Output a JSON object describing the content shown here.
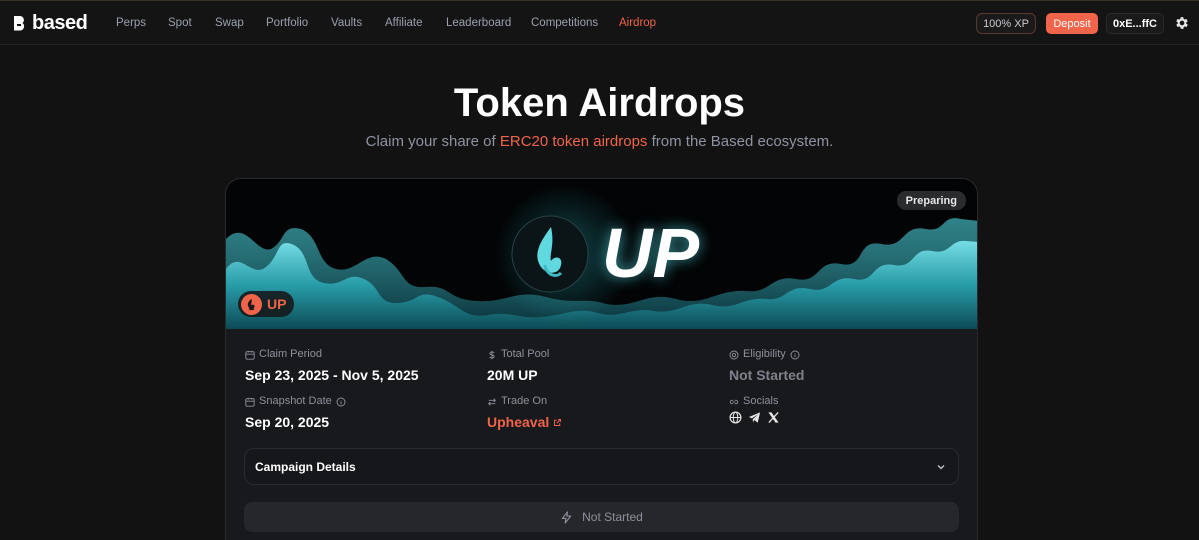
{
  "brand": {
    "name": "based"
  },
  "nav": {
    "items": [
      {
        "label": "Perps"
      },
      {
        "label": "Spot"
      },
      {
        "label": "Swap"
      },
      {
        "label": "Portfolio"
      },
      {
        "label": "Vaults"
      },
      {
        "label": "Affiliate"
      },
      {
        "label": "Leaderboard"
      },
      {
        "label": "Competitions"
      },
      {
        "label": "Airdrop",
        "active": true
      }
    ],
    "xp_label": "100% XP",
    "deposit_label": "Deposit",
    "wallet_label": "0xE...ffC",
    "settings_icon": "gear-icon"
  },
  "page": {
    "title": "Token Airdrops",
    "subtitle_prefix": "Claim your share of ",
    "subtitle_highlight": "ERC20 token airdrops",
    "subtitle_suffix": " from the Based ecosystem."
  },
  "campaign": {
    "banner_text": "UP",
    "status_badge": "Preparing",
    "token_symbol": "UP",
    "claim_period_label": "Claim Period",
    "claim_period_value": "Sep 23, 2025 - Nov 5, 2025",
    "total_pool_label": "Total Pool",
    "total_pool_value": "20M UP",
    "eligibility_label": "Eligibility",
    "eligibility_value": "Not Started",
    "snapshot_label": "Snapshot Date",
    "snapshot_value": "Sep 20, 2025",
    "trade_on_label": "Trade On",
    "trade_on_value": "Upheaval",
    "socials_label": "Socials",
    "socials": [
      "globe-icon",
      "telegram-icon",
      "x-icon"
    ],
    "details_label": "Campaign Details",
    "action_label": "Not Started"
  },
  "colors": {
    "accent": "#f0644a",
    "background": "#121212",
    "card": "#18191c",
    "flame": "#2fc4cf"
  }
}
